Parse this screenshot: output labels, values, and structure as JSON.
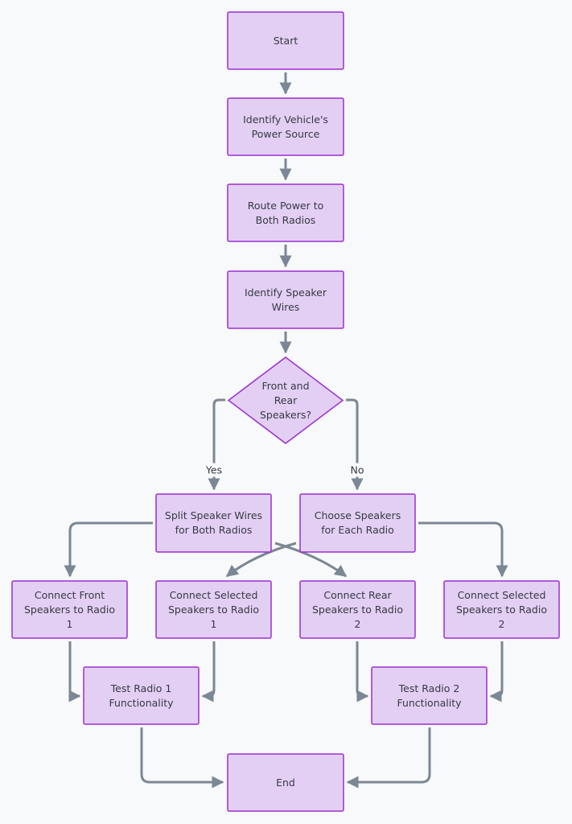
{
  "colors": {
    "node_fill": "#e4cff4",
    "node_border": "#9a2fd1",
    "edge": "#7b8794",
    "background": "#f8f9fa",
    "text": "#333a44"
  },
  "nodes": {
    "start": {
      "label": "Start",
      "shape": "rect"
    },
    "power": {
      "label": "Identify Vehicle's Power Source",
      "shape": "rect"
    },
    "route": {
      "label": "Route Power to Both Radios",
      "shape": "rect"
    },
    "wires": {
      "label": "Identify Speaker Wires",
      "shape": "rect"
    },
    "decision": {
      "label": "Front and Rear Speakers?",
      "shape": "diamond"
    },
    "split": {
      "label": "Split Speaker Wires for Both Radios",
      "shape": "rect"
    },
    "choose": {
      "label": "Choose Speakers for Each Radio",
      "shape": "rect"
    },
    "front": {
      "label": "Connect Front Speakers to Radio 1",
      "shape": "rect"
    },
    "sel1": {
      "label": "Connect Selected Speakers to Radio 1",
      "shape": "rect"
    },
    "rear": {
      "label": "Connect Rear Speakers to Radio 2",
      "shape": "rect"
    },
    "sel2": {
      "label": "Connect Selected Speakers to Radio 2",
      "shape": "rect"
    },
    "test1": {
      "label": "Test Radio 1 Functionality",
      "shape": "rect"
    },
    "test2": {
      "label": "Test Radio 2 Functionality",
      "shape": "rect"
    },
    "end": {
      "label": "End",
      "shape": "rect"
    }
  },
  "edges": [
    {
      "from": "start",
      "to": "power"
    },
    {
      "from": "power",
      "to": "route"
    },
    {
      "from": "route",
      "to": "wires"
    },
    {
      "from": "wires",
      "to": "decision"
    },
    {
      "from": "decision",
      "to": "split",
      "label": "Yes"
    },
    {
      "from": "decision",
      "to": "choose",
      "label": "No"
    },
    {
      "from": "split",
      "to": "front"
    },
    {
      "from": "split",
      "to": "rear"
    },
    {
      "from": "choose",
      "to": "sel1"
    },
    {
      "from": "choose",
      "to": "sel2"
    },
    {
      "from": "front",
      "to": "test1"
    },
    {
      "from": "sel1",
      "to": "test1"
    },
    {
      "from": "rear",
      "to": "test2"
    },
    {
      "from": "sel2",
      "to": "test2"
    },
    {
      "from": "test1",
      "to": "end"
    },
    {
      "from": "test2",
      "to": "end"
    }
  ]
}
